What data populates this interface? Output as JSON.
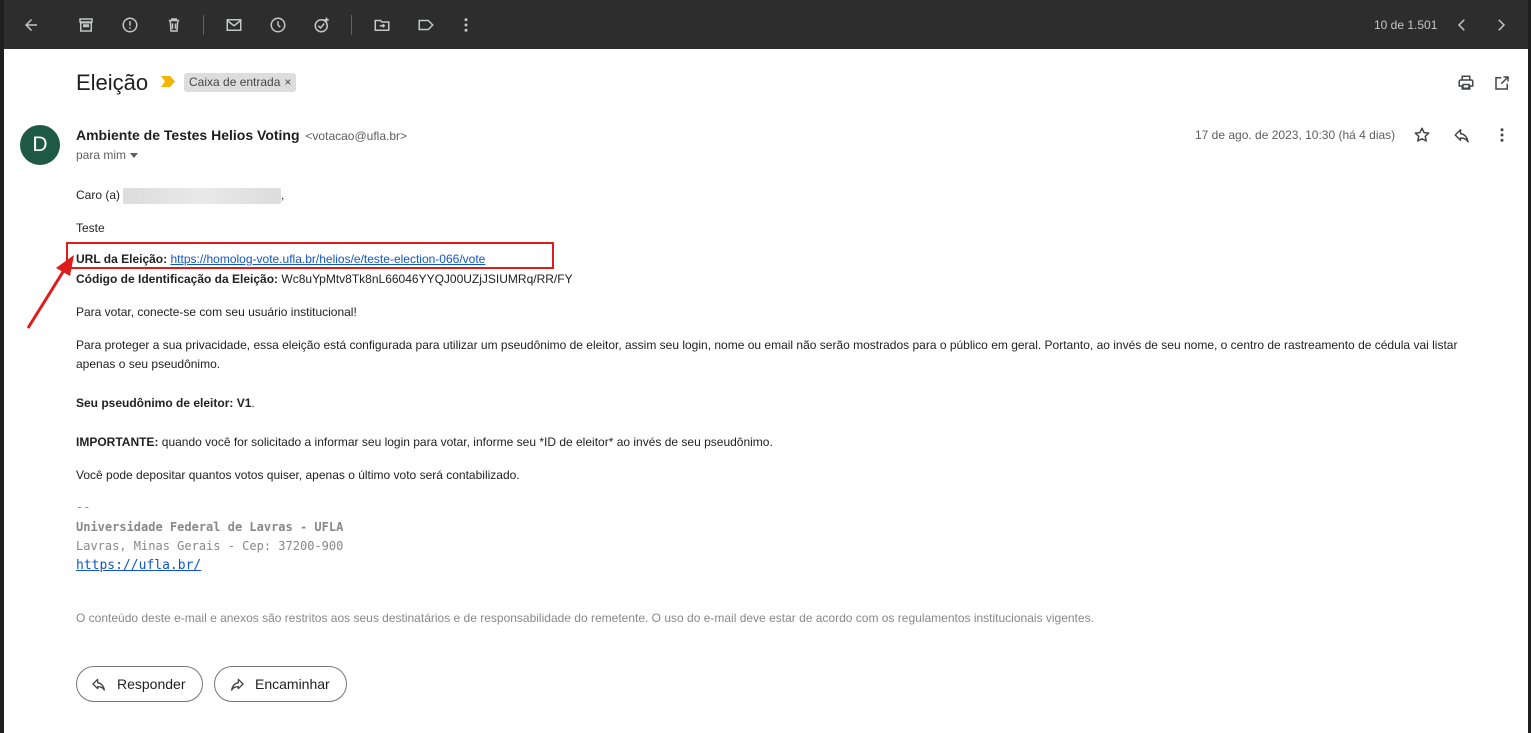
{
  "toolbar": {
    "icons": [
      "back-arrow-icon",
      "archive-icon",
      "report-spam-icon",
      "delete-icon",
      "mark-unread-icon",
      "snooze-icon",
      "add-task-icon",
      "move-to-icon",
      "label-icon",
      "more-vert-icon",
      "newer-chevron-icon",
      "older-chevron-icon"
    ],
    "count": "10 de 1.501"
  },
  "email": {
    "subject": "Eleição",
    "label_chip": "Caixa de entrada",
    "label_close": "×",
    "avatar_letter": "D",
    "sender_name": "Ambiente de Testes Helios Voting",
    "sender_email": "<votacao@ufla.br>",
    "to_me": "para mim",
    "date": "17 de ago. de 2023, 10:30 (há 4 dias)"
  },
  "body": {
    "greeting_prefix": "Caro (a)",
    "greeting_suffix": ",",
    "line_teste": "Teste",
    "url_label": "URL da Eleição:",
    "url_value": "https://homolog-vote.ufla.br/helios/e/teste-election-066/vote",
    "code_label": "Código de Identificação da Eleição:",
    "code_value": "Wc8uYpMtv8Tk8nL66046YYQJ00UZjJSIUMRq/RR/FY",
    "vote_instruction": "Para votar, conecte-se com seu usuário institucional!",
    "privacy_text": "Para proteger a sua privacidade, essa eleição está configurada para utilizar um pseudônimo de eleitor, assim seu login, nome ou email não serão mostrados para o público em geral. Portanto, ao invés de seu nome, o centro de rastreamento de cédula vai listar apenas o seu pseudônimo.",
    "pseudonym_label": "Seu pseudônimo de eleitor: V1",
    "pseudonym_suffix": ".",
    "important_label": "IMPORTANTE:",
    "important_text": "quando você for solicitado a informar seu login para votar, informe seu *ID de eleitor* ao invés de seu pseudônimo.",
    "multiple_votes": "Você pode depositar quantos votos quiser, apenas o último voto será contabilizado."
  },
  "signature": {
    "dashes": "--",
    "org": "Universidade Federal de Lavras - UFLA",
    "address": "Lavras, Minas Gerais - Cep: 37200-900",
    "link": "https://ufla.br/"
  },
  "disclaimer": "O conteúdo deste e-mail e anexos são restritos aos seus destinatários e de responsabilidade do remetente. O uso do e-mail deve estar de acordo com os regulamentos institucionais vigentes.",
  "actions": {
    "reply": "Responder",
    "forward": "Encaminhar"
  },
  "colors": {
    "avatar": "#1e5a46",
    "link": "#1155cc",
    "annotation": "#e01b1b",
    "importance": "#f4b400"
  }
}
